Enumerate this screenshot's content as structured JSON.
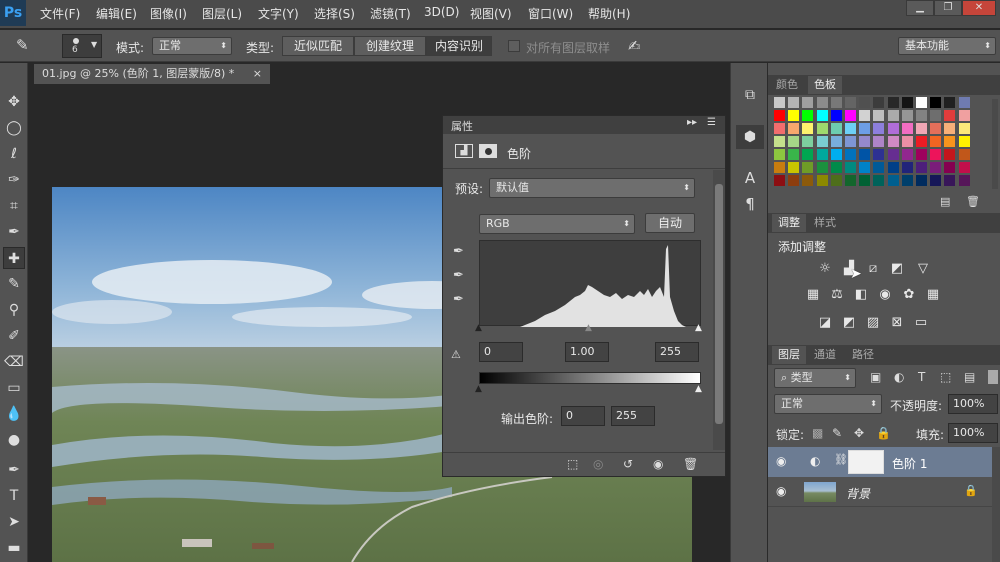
{
  "app": {
    "logo": "Ps"
  },
  "menu": [
    "文件(F)",
    "编辑(E)",
    "图像(I)",
    "图层(L)",
    "文字(Y)",
    "选择(S)",
    "滤镜(T)",
    "3D(D)",
    "视图(V)",
    "窗口(W)",
    "帮助(H)"
  ],
  "window_controls": [
    "▁",
    "❐",
    "✕"
  ],
  "options": {
    "brush_size": "6",
    "mode_label": "模式:",
    "mode_value": "正常",
    "type_label": "类型:",
    "type_options": [
      "近似匹配",
      "创建纹理",
      "内容识别"
    ],
    "type_selected": "内容识别",
    "sample_all_label": "对所有图层取样",
    "workspace": "基本功能"
  },
  "document": {
    "tab_title": "01.jpg @ 25% (色阶 1, 图层蒙版/8) *",
    "close": "×"
  },
  "properties": {
    "header": "属性",
    "title": "色阶",
    "preset_label": "预设:",
    "preset_value": "默认值",
    "channel": "RGB",
    "auto_button": "自动",
    "input_black": "0",
    "input_gamma": "1.00",
    "input_white": "255",
    "output_label": "输出色阶:",
    "output_black": "0",
    "output_white": "255"
  },
  "swatches_panel": {
    "tabs": [
      "颜色",
      "色板"
    ],
    "active": "色板",
    "colors": [
      [
        "#c8c8c8",
        "#b4b4b4",
        "#a0a0a0",
        "#8c8c8c",
        "#787878",
        "#646464",
        "#505050",
        "#3c3c3c",
        "#282828",
        "#141414",
        "#ffffff",
        "#000000",
        "#202020",
        "#6f7bb0"
      ],
      [
        "#ff0000",
        "#ffff00",
        "#00ff00",
        "#00ffff",
        "#0000ff",
        "#ff00ff",
        "#d2d2d2",
        "#bebebe",
        "#aaaaaa",
        "#969696",
        "#828282",
        "#6e6e6e",
        "#e13c3c",
        "#f0a0a0"
      ],
      [
        "#f26d6d",
        "#f7a86d",
        "#fdf26d",
        "#9fd96d",
        "#6dcdaf",
        "#6dcff6",
        "#6d9ee6",
        "#8d7fdc",
        "#b06dd9",
        "#f26dc2",
        "#f2a6b5",
        "#e36f5a",
        "#f7b079",
        "#fce87a"
      ],
      [
        "#c5e08c",
        "#a6d787",
        "#7dcf9f",
        "#7acdd1",
        "#78aedb",
        "#7e96d4",
        "#9589cc",
        "#ae84c7",
        "#d08ac5",
        "#ec8fa6",
        "#ed1c24",
        "#f26522",
        "#f7941d",
        "#fff200"
      ],
      [
        "#8dc63f",
        "#39b54a",
        "#00a651",
        "#00a99d",
        "#00aeef",
        "#0072bc",
        "#0054a6",
        "#2e3192",
        "#662d91",
        "#92278f",
        "#9e005d",
        "#ed145b",
        "#c4161c",
        "#c1571a"
      ],
      [
        "#c77c0e",
        "#c9c400",
        "#6f9c27",
        "#1b913e",
        "#008a4a",
        "#008a80",
        "#0082c8",
        "#005a98",
        "#003f87",
        "#21247a",
        "#4d1f7a",
        "#7a1d7a",
        "#850050",
        "#c10f4b"
      ],
      [
        "#8c0e12",
        "#8c3d0e",
        "#8c5a0b",
        "#8c8900",
        "#4e6e1b",
        "#13662c",
        "#006134",
        "#00625a",
        "#005f8f",
        "#003f6b",
        "#002b5e",
        "#161758",
        "#381659",
        "#561659"
      ]
    ]
  },
  "adjustments_panel": {
    "tabs": [
      "调整",
      "样式"
    ],
    "active": "调整",
    "heading": "添加调整",
    "row1": [
      "brightness-icon",
      "levels-icon",
      "curves-icon",
      "exposure-icon",
      "vibrance-icon"
    ],
    "row2": [
      "huesat-icon",
      "colorbalance-icon",
      "bw-icon",
      "photofilter-icon",
      "channelmixer-icon",
      "colorlookup-icon"
    ],
    "row3": [
      "invert-icon",
      "posterize-icon",
      "threshold-icon",
      "selectivecolor-icon",
      "gradientmap-icon"
    ]
  },
  "layers_panel": {
    "tabs": [
      "图层",
      "通道",
      "路径"
    ],
    "active": "图层",
    "filter": "类型",
    "blend_mode": "正常",
    "opacity_label": "不透明度:",
    "opacity": "100%",
    "lock_label": "锁定:",
    "fill_label": "填充:",
    "fill": "100%",
    "layers": [
      {
        "name": "色阶 1",
        "selected": true
      },
      {
        "name": "背景",
        "selected": false
      }
    ]
  },
  "right_icon_column": [
    "history-icon",
    "3d-icon",
    "character-icon",
    "paragraph-icon"
  ]
}
